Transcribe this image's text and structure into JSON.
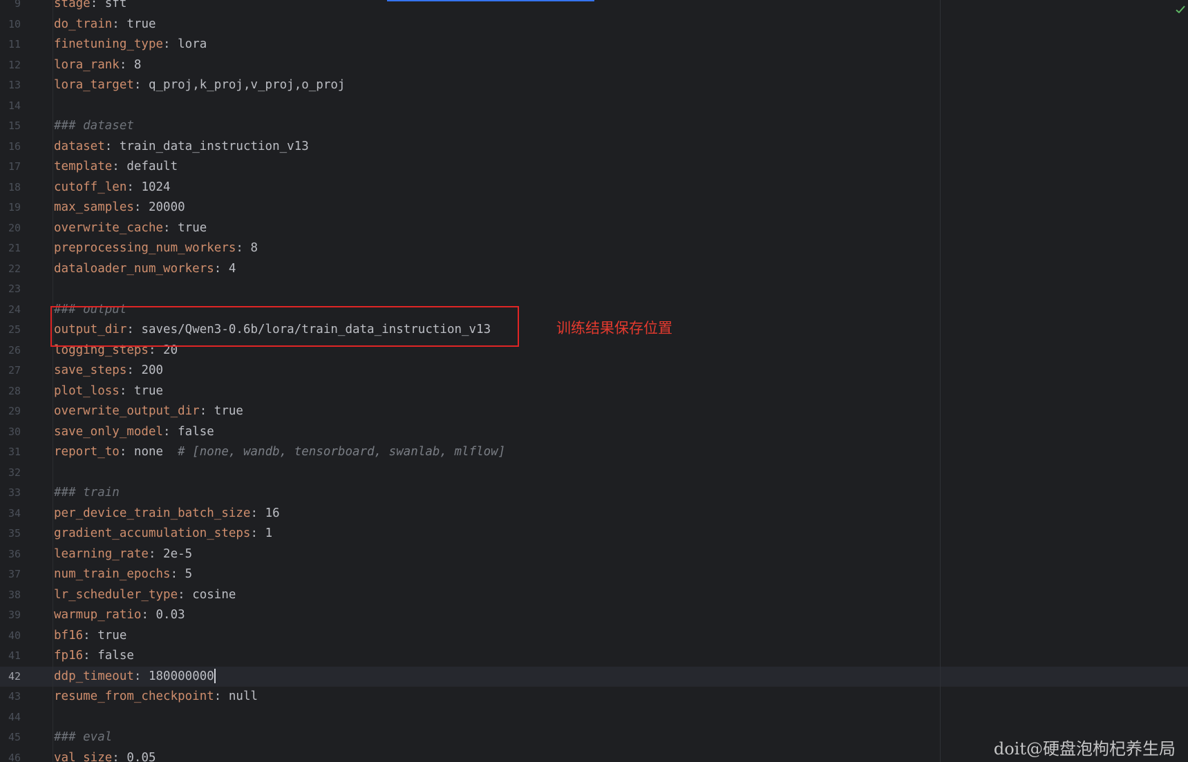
{
  "annotation": "训练结果保存位置",
  "watermark": "doit@硬盘泡枸杞养生局",
  "active_line": "42",
  "lines": [
    {
      "n": "9",
      "k": "stage",
      "v": "sft"
    },
    {
      "n": "10",
      "k": "do_train",
      "v": "true"
    },
    {
      "n": "11",
      "k": "finetuning_type",
      "v": "lora"
    },
    {
      "n": "12",
      "k": "lora_rank",
      "v": "8"
    },
    {
      "n": "13",
      "k": "lora_target",
      "v": "q_proj,k_proj,v_proj,o_proj"
    },
    {
      "n": "14"
    },
    {
      "n": "15",
      "c": "### dataset"
    },
    {
      "n": "16",
      "k": "dataset",
      "v": "train_data_instruction_v13"
    },
    {
      "n": "17",
      "k": "template",
      "v": "default"
    },
    {
      "n": "18",
      "k": "cutoff_len",
      "v": "1024"
    },
    {
      "n": "19",
      "k": "max_samples",
      "v": "20000"
    },
    {
      "n": "20",
      "k": "overwrite_cache",
      "v": "true"
    },
    {
      "n": "21",
      "k": "preprocessing_num_workers",
      "v": "8"
    },
    {
      "n": "22",
      "k": "dataloader_num_workers",
      "v": "4"
    },
    {
      "n": "23"
    },
    {
      "n": "24",
      "c": "### output"
    },
    {
      "n": "25",
      "k": "output_dir",
      "v": "saves/Qwen3-0.6b/lora/train_data_instruction_v13"
    },
    {
      "n": "26",
      "k": "logging_steps",
      "v": "20"
    },
    {
      "n": "27",
      "k": "save_steps",
      "v": "200"
    },
    {
      "n": "28",
      "k": "plot_loss",
      "v": "true"
    },
    {
      "n": "29",
      "k": "overwrite_output_dir",
      "v": "true"
    },
    {
      "n": "30",
      "k": "save_only_model",
      "v": "false"
    },
    {
      "n": "31",
      "k": "report_to",
      "v": "none",
      "tail": "# [none, wandb, tensorboard, swanlab, mlflow]"
    },
    {
      "n": "32"
    },
    {
      "n": "33",
      "c": "### train"
    },
    {
      "n": "34",
      "k": "per_device_train_batch_size",
      "v": "16"
    },
    {
      "n": "35",
      "k": "gradient_accumulation_steps",
      "v": "1"
    },
    {
      "n": "36",
      "k": "learning_rate",
      "v": "2e-5"
    },
    {
      "n": "37",
      "k": "num_train_epochs",
      "v": "5"
    },
    {
      "n": "38",
      "k": "lr_scheduler_type",
      "v": "cosine"
    },
    {
      "n": "39",
      "k": "warmup_ratio",
      "v": "0.03"
    },
    {
      "n": "40",
      "k": "bf16",
      "v": "true"
    },
    {
      "n": "41",
      "k": "fp16",
      "v": "false"
    },
    {
      "n": "42",
      "k": "ddp_timeout",
      "v": "180000000"
    },
    {
      "n": "43",
      "k": "resume_from_checkpoint",
      "v": "null"
    },
    {
      "n": "44"
    },
    {
      "n": "45",
      "c": "### eval"
    },
    {
      "n": "46",
      "k": "val_size",
      "v": "0.05"
    }
  ]
}
